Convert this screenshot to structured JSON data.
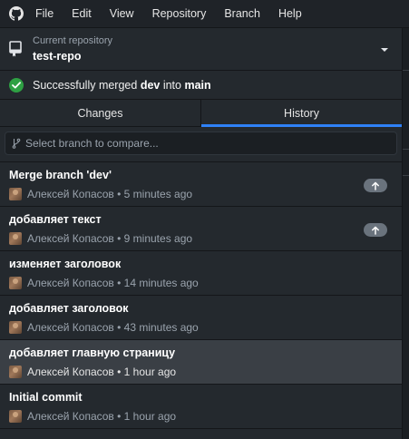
{
  "menubar": {
    "items": [
      "File",
      "Edit",
      "View",
      "Repository",
      "Branch",
      "Help"
    ]
  },
  "repo": {
    "label": "Current repository",
    "name": "test-repo"
  },
  "banner": {
    "prefix": "Successfully merged ",
    "source_branch": "dev",
    "middle": " into ",
    "target_branch": "main"
  },
  "tabs": [
    {
      "label": "Changes",
      "active": false
    },
    {
      "label": "History",
      "active": true
    }
  ],
  "filter": {
    "placeholder": "Select branch to compare..."
  },
  "commits": [
    {
      "title": "Merge branch 'dev'",
      "meta": "Алексей Копасов • 5 minutes ago",
      "unpushed": true,
      "selected": false
    },
    {
      "title": "добавляет текст",
      "meta": "Алексей Копасов • 9 minutes ago",
      "unpushed": true,
      "selected": false
    },
    {
      "title": "изменяет заголовок",
      "meta": "Алексей Копасов • 14 minutes ago",
      "unpushed": false,
      "selected": false
    },
    {
      "title": "добавляет заголовок",
      "meta": "Алексей Копасов • 43 minutes ago",
      "unpushed": false,
      "selected": false
    },
    {
      "title": "добавляет главную страницу",
      "meta": "Алексей Копасов • 1 hour ago",
      "unpushed": false,
      "selected": true
    },
    {
      "title": "Initial commit",
      "meta": "Алексей Копасов • 1 hour ago",
      "unpushed": false,
      "selected": false
    }
  ],
  "colors": {
    "accent": "#2f81f7",
    "success": "#2ea043",
    "background": "#24292e",
    "selected_row": "#3a3f45"
  },
  "icons": {
    "logo": "github-icon",
    "repo": "repo-icon",
    "caret": "chevron-down-icon",
    "success": "check-circle-icon",
    "filter": "git-branch-icon",
    "unpushed": "arrow-up-icon"
  }
}
